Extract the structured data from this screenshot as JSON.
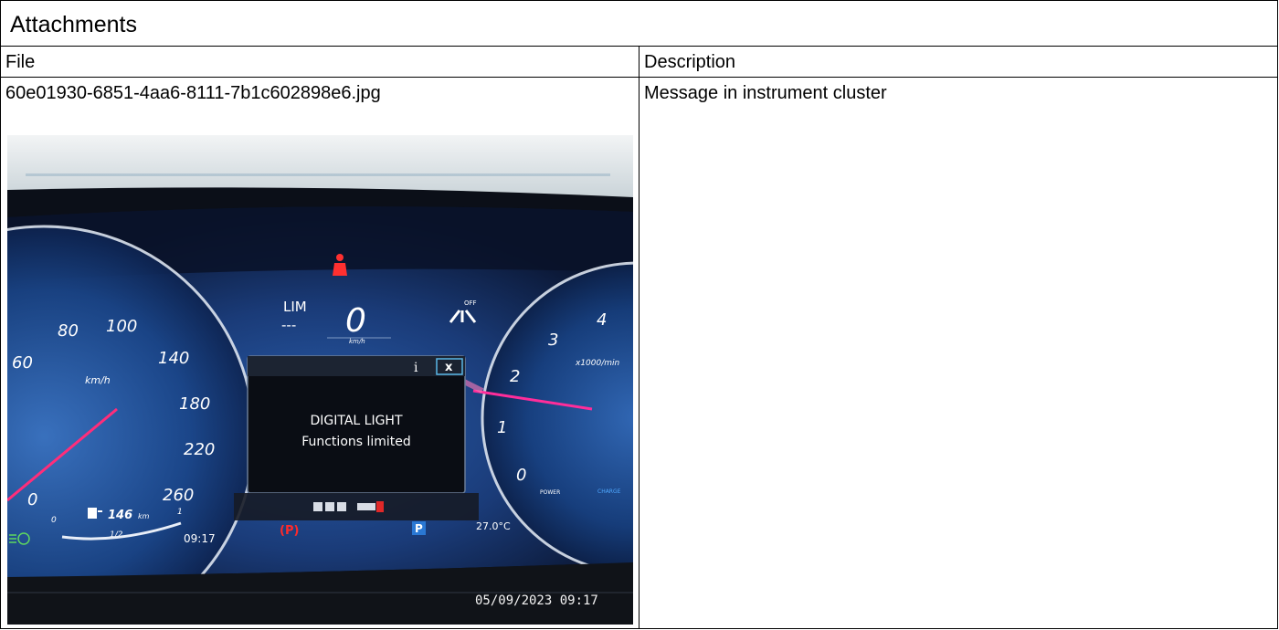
{
  "panel": {
    "title": "Attachments"
  },
  "table": {
    "columns": [
      "File",
      "Description"
    ],
    "rows": [
      {
        "file": "60e01930-6851-4aa6-8111-7b1c602898e6.jpg",
        "description": "Message in instrument cluster"
      }
    ]
  },
  "photo": {
    "speed": "0",
    "speed_unit": "km/h",
    "lim_label": "LIM",
    "lim_value": "---",
    "assist_status": "OFF",
    "speed_unit_gauge": "km/h",
    "speed_ticks": [
      "60",
      "80",
      "100",
      "140",
      "180",
      "220",
      "260",
      "0"
    ],
    "rpm_ticks": [
      "3",
      "4",
      "2",
      "1",
      "0"
    ],
    "rpm_unit": "x1000/min",
    "power_label": "POWER",
    "charge_label": "CHARGE",
    "message_title": "DIGITAL LIGHT",
    "message_body": "Functions limited",
    "info_icon": "i",
    "close_icon": "x",
    "range": "146",
    "range_unit": "km",
    "fuel_zero": "0",
    "fuel_half": "1/2",
    "fuel_one": "1",
    "time": "09:17",
    "parking_brake": "(P)",
    "gear": "P",
    "temperature": "27.0°C",
    "timestamp": "05/09/2023 09:17"
  }
}
